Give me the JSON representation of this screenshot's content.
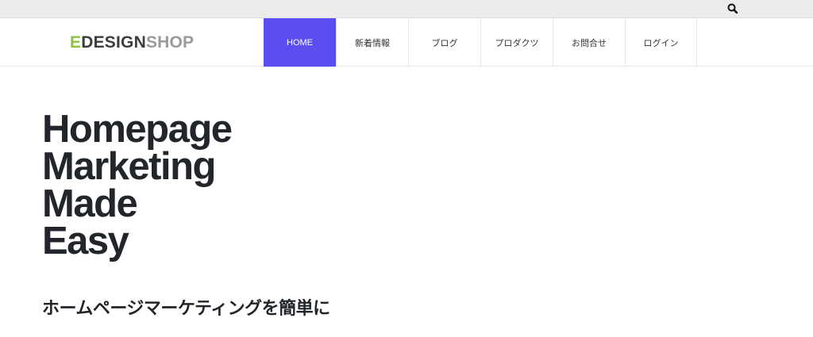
{
  "topbar": {
    "search_icon": "search-icon"
  },
  "logo": {
    "part1": "E",
    "part2": "DESIGN",
    "part3": "SHOP",
    "colors": {
      "e": "#8cc63f",
      "design": "#3d3d3d",
      "shop": "#9a9a9a"
    }
  },
  "nav": {
    "items": [
      {
        "label": "HOME",
        "active": true
      },
      {
        "label": "新着情報"
      },
      {
        "label": "ブログ"
      },
      {
        "label": "プロダクツ"
      },
      {
        "label": "お問合せ"
      },
      {
        "label": "ログイン"
      }
    ],
    "active_color": "#5b4ef0"
  },
  "hero": {
    "line1": "Homepage",
    "line2": "Marketing",
    "line3": "Made",
    "line4": "Easy"
  },
  "subtitle": "ホームページマーケティングを簡単に"
}
